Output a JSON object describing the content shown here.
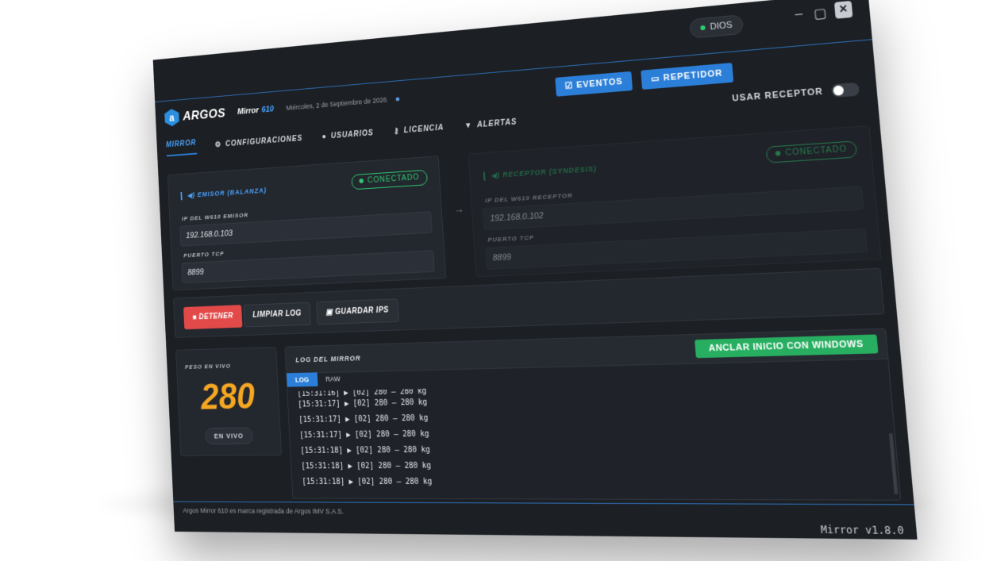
{
  "header": {
    "brand": "ARGOS",
    "product_label": "Mirror",
    "product_number": "610",
    "date": "Miércoles, 2 de Septiembre de 2026",
    "user_badge": "DIOS",
    "eventos_label": "EVENTOS",
    "repetidor_label": "REPETIDOR"
  },
  "nav": {
    "items": [
      {
        "label": "MIRROR",
        "icon": "",
        "active": true
      },
      {
        "label": "CONFIGURACIONES",
        "icon": "gears-icon"
      },
      {
        "label": "USUARIOS",
        "icon": "user-icon"
      },
      {
        "label": "LICENCIA",
        "icon": "key-icon"
      },
      {
        "label": "ALERTAS",
        "icon": "warning-icon"
      }
    ],
    "usar_receptor": "USAR RECEPTOR"
  },
  "emisor": {
    "title": "EMISOR (BALANZA)",
    "status": "CONECTADO",
    "ip_label": "IP DEL W610 EMISOR",
    "ip_value": "192.168.0.103",
    "port_label": "PUERTO TCP",
    "port_value": "8899"
  },
  "receptor": {
    "title": "RECEPTOR (SYNDESIS)",
    "status": "CONECTADO",
    "ip_label": "IP DEL W610 RECEPTOR",
    "ip_value": "192.168.0.102",
    "port_label": "PUERTO TCP",
    "port_value": "8899"
  },
  "actions": {
    "detener": "DETENER",
    "limpiar": "LIMPIAR LOG",
    "guardar": "GUARDAR IPS"
  },
  "peso": {
    "label": "PESO EN VIVO",
    "value": "280",
    "badge": "EN VIVO"
  },
  "log": {
    "title": "LOG DEL MIRROR",
    "anclar": "ANCLAR INICIO CON WINDOWS",
    "tabs": [
      "LOG",
      "RAW"
    ],
    "lines": [
      "[15:31:16] ▶ [02] 280 – 280 kg",
      "[15:31:17] ▶ [02] 280 – 280 kg",
      "[15:31:17] ▶ [02] 280 – 280 kg",
      "[15:31:17] ▶ [02] 280 – 280 kg",
      "[15:31:18] ▶ [02] 280 – 280 kg",
      "[15:31:18] ▶ [02] 280 – 280 kg",
      "[15:31:18] ▶ [02] 280 – 280 kg"
    ]
  },
  "footer": {
    "left": "Argos Mirror 610 es marca registrada de Argos IMV S.A.S.",
    "right": "Mirror v1.8.0"
  }
}
